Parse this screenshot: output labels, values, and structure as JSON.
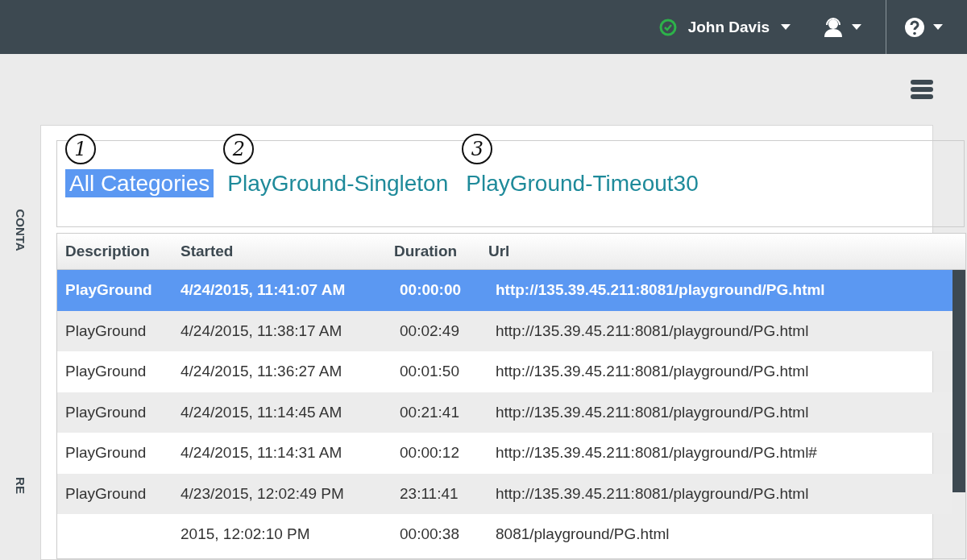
{
  "top_bar": {
    "status": {
      "color": "#2db24a"
    },
    "user_name": "John Davis"
  },
  "sidebar": {
    "items": [
      {
        "label": "CONTA"
      },
      {
        "label": "RE"
      }
    ]
  },
  "categories": [
    {
      "label": "All Categories",
      "selected": true,
      "callout": "1"
    },
    {
      "label": "PlayGround-Singleton",
      "selected": false,
      "callout": "2"
    },
    {
      "label": "PlayGround-Timeout30",
      "selected": false,
      "callout": "3"
    }
  ],
  "table": {
    "columns": [
      "Description",
      "Started",
      "Duration",
      "Url"
    ],
    "rows": [
      {
        "selected": true,
        "cells": [
          "PlayGround",
          "4/24/2015, 11:41:07 AM",
          "00:00:00",
          "http://135.39.45.211:8081/playground/PG.html"
        ]
      },
      {
        "selected": false,
        "cells": [
          "PlayGround",
          "4/24/2015, 11:38:17 AM",
          "00:02:49",
          "http://135.39.45.211:8081/playground/PG.html"
        ]
      },
      {
        "selected": false,
        "cells": [
          "PlayGround",
          "4/24/2015, 11:36:27 AM",
          "00:01:50",
          "http://135.39.45.211:8081/playground/PG.html"
        ]
      },
      {
        "selected": false,
        "cells": [
          "PlayGround",
          "4/24/2015, 11:14:45 AM",
          "00:21:41",
          "http://135.39.45.211:8081/playground/PG.html"
        ]
      },
      {
        "selected": false,
        "cells": [
          "PlayGround",
          "4/24/2015, 11:14:31 AM",
          "00:00:12",
          "http://135.39.45.211:8081/playground/PG.html#"
        ]
      },
      {
        "selected": false,
        "cells": [
          "PlayGround",
          "4/23/2015, 12:02:49 PM",
          "23:11:41",
          "http://135.39.45.211:8081/playground/PG.html"
        ]
      },
      {
        "selected": false,
        "cells": [
          "",
          "2015, 12:02:10 PM",
          "00:00:38",
          "8081/playground/PG.html"
        ]
      }
    ]
  }
}
